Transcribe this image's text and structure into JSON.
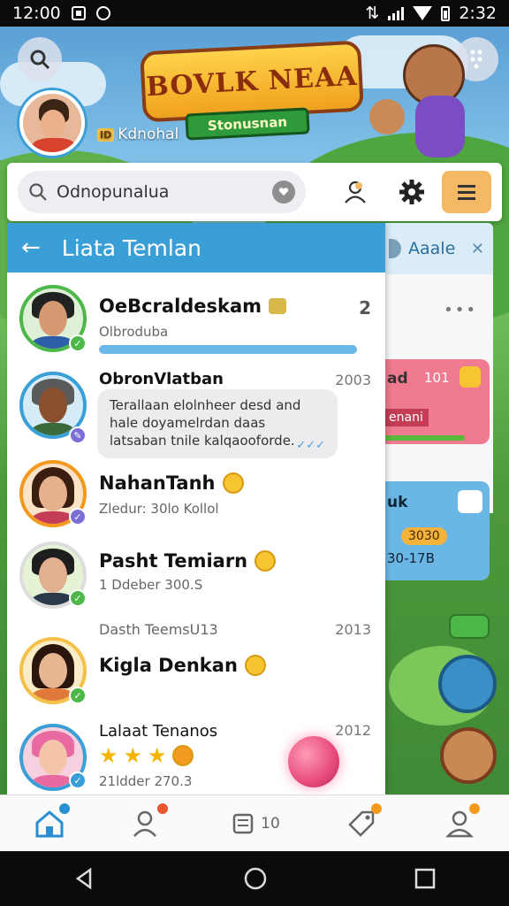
{
  "status_bar": {
    "time": "12:00",
    "clock": "2:32"
  },
  "game": {
    "logo_title": "BOVLK NEAA",
    "logo_subtitle": "Stonusnan",
    "profile_tag": "ID",
    "profile_name": "Kdnohal"
  },
  "search": {
    "value": "Odnopunalua",
    "placeholder": ""
  },
  "friends_panel": {
    "title": "Liata Temlan",
    "friends": [
      {
        "name": "OeBcraldeskam",
        "sub": "Olbroduba",
        "badge": "2",
        "progress": 1.0
      },
      {
        "name": "ObronVlatban",
        "year": "2003",
        "message": "Terallaan elolnheer desd and hale doyamelrdan daas latsaban tnile kalqaooforde."
      },
      {
        "name": "NahanTanh",
        "sub": "Zledur: 30lo Kollol"
      },
      {
        "name": "Pasht Temiarn",
        "sub": "1 Ddeber 300.S"
      },
      {
        "name": "Kigla Denkan",
        "section": "Dasth TeemsU13",
        "year": "2013"
      },
      {
        "name": "Lalaat Tenanos",
        "sub": "21ldder 270.3",
        "year": "2012",
        "stars": 3
      }
    ]
  },
  "side_panel": {
    "title": "Aaale",
    "card1_title": "ad",
    "card1_num": "101",
    "card1_footer": "enani",
    "card2_title": "uk",
    "card2_score": "3030",
    "card2_range": "30-17B"
  },
  "bottom_nav": {
    "inventory_count": "10"
  },
  "colors": {
    "primary": "#3a9fd6",
    "accent": "#f5b865",
    "online": "#4db848",
    "away": "#7a6fd6"
  }
}
